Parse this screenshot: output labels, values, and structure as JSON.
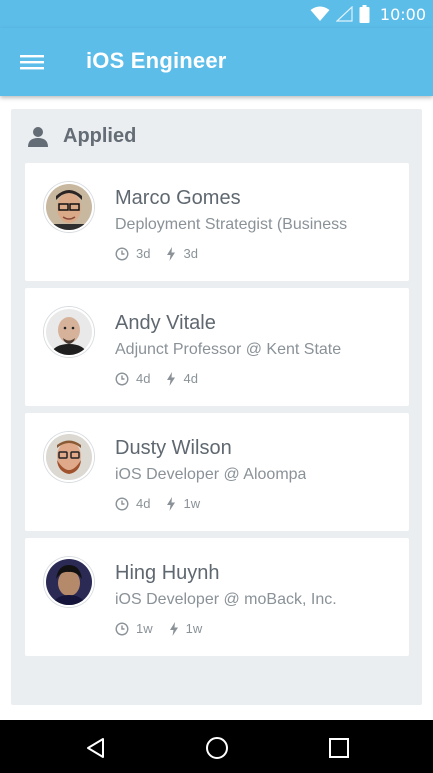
{
  "status_bar": {
    "time": "10:00",
    "icons": [
      "wifi-icon",
      "signal-icon",
      "battery-icon"
    ]
  },
  "app_bar": {
    "title": "iOS Engineer",
    "menu_icon": "hamburger-menu-icon"
  },
  "section": {
    "title": "Applied",
    "icon": "person-icon"
  },
  "candidates": [
    {
      "name": "Marco Gomes",
      "role": "Deployment Strategist (Business",
      "time_since": "3d",
      "activity": "3d"
    },
    {
      "name": "Andy Vitale",
      "role": "Adjunct Professor @ Kent State",
      "time_since": "4d",
      "activity": "4d"
    },
    {
      "name": "Dusty Wilson",
      "role": "iOS Developer @ Aloompa",
      "time_since": "4d",
      "activity": "1w"
    },
    {
      "name": "Hing Huynh",
      "role": "iOS Developer @ moBack, Inc.",
      "time_since": "1w",
      "activity": "1w"
    }
  ],
  "navigation": {
    "buttons": [
      "back-icon",
      "home-icon",
      "recents-icon"
    ]
  },
  "colors": {
    "primary": "#5dbde9",
    "panel_bg": "#ebeef0",
    "text_dark": "#5f6870",
    "text_light": "#8a9298"
  }
}
